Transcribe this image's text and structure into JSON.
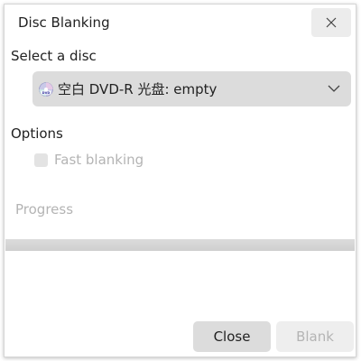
{
  "window": {
    "title": "Disc Blanking"
  },
  "disc_section": {
    "label": "Select a disc",
    "selected_disc": "空白 DVD-R 光盘: empty",
    "icon": "dvd-disc-icon"
  },
  "options_section": {
    "label": "Options",
    "fast_blanking_label": "Fast blanking",
    "fast_blanking_checked": false,
    "fast_blanking_enabled": false
  },
  "progress_section": {
    "label": "Progress"
  },
  "buttons": {
    "close_label": "Close",
    "blank_label": "Blank"
  },
  "colors": {
    "combo_bg": "#dcdcdc",
    "button_bg": "#dcdcdc",
    "disabled_text": "#b4b4b4"
  }
}
